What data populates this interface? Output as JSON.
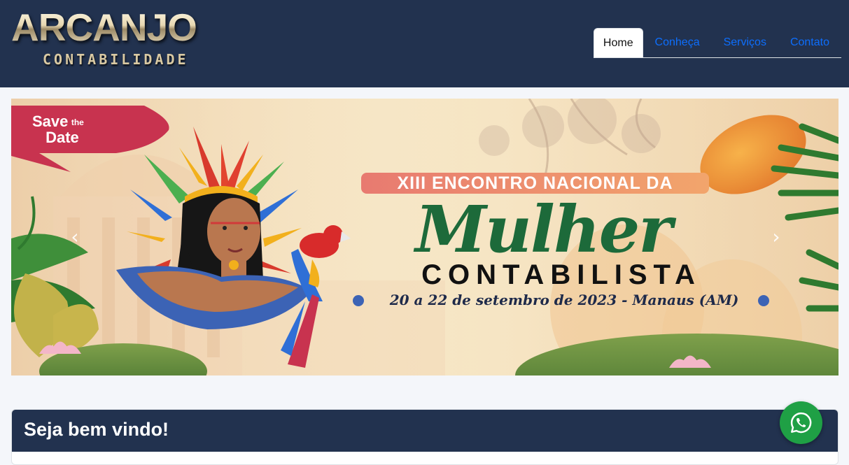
{
  "brand": {
    "name": "ARCANJO",
    "tagline": "CONTABILIDADE"
  },
  "nav": {
    "items": [
      {
        "label": "Home",
        "active": true
      },
      {
        "label": "Conheça",
        "active": false
      },
      {
        "label": "Serviços",
        "active": false
      },
      {
        "label": "Contato",
        "active": false
      }
    ]
  },
  "carousel": {
    "slide": {
      "badge_line1": "Save",
      "badge_the": "the",
      "badge_line2": "Date",
      "event_banner": "XIII ENCONTRO NACIONAL DA",
      "event_title": "Mulher",
      "event_subtitle": "CONTABILISTA",
      "event_date": "20 a 22 de setembro de 2023 - Manaus (AM)"
    },
    "prev_icon": "chevron-left-icon",
    "next_icon": "chevron-right-icon"
  },
  "welcome": {
    "title": "Seja bem vindo!"
  },
  "whatsapp": {
    "icon": "whatsapp-icon"
  },
  "colors": {
    "header_bg": "#22324f",
    "link": "#0d6efd",
    "whatsapp": "#1fa045",
    "event_green": "#1d6a3a"
  }
}
